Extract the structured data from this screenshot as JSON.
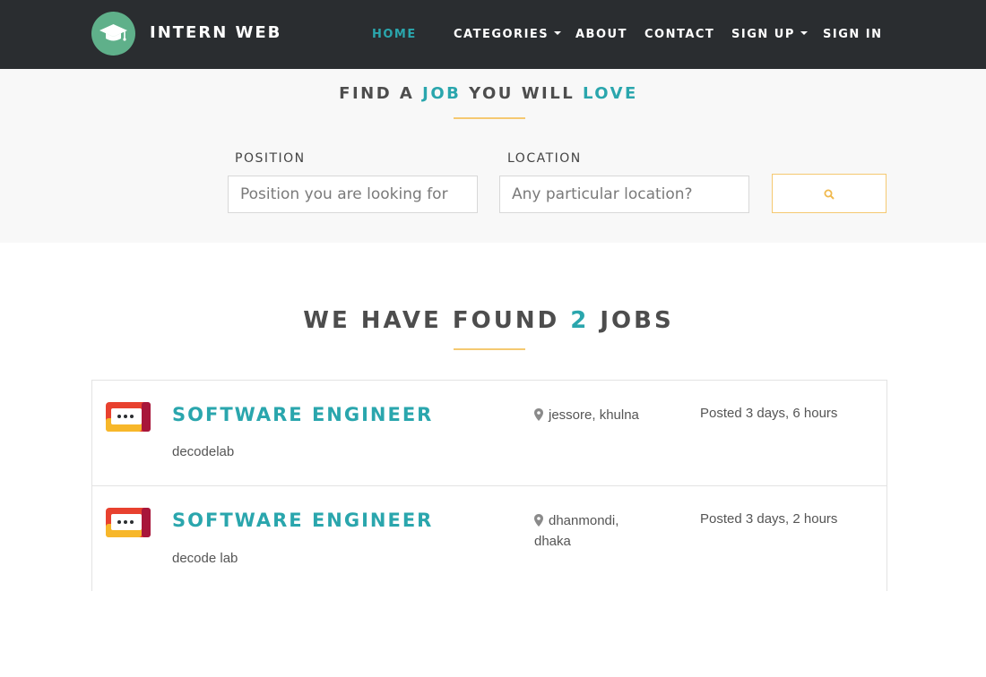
{
  "navbar": {
    "brand": "INTERN WEB",
    "items": [
      {
        "label": "HOME",
        "active": true
      },
      {
        "label": "CATEGORIES",
        "dropdown": true
      },
      {
        "label": "ABOUT"
      },
      {
        "label": "CONTACT"
      },
      {
        "label": "SIGN UP",
        "dropdown": true
      },
      {
        "label": "SIGN IN"
      }
    ]
  },
  "search": {
    "title_prefix": "FIND A ",
    "title_accent_1": "JOB",
    "title_middle": " YOU WILL ",
    "title_accent_2": "LOVE",
    "position_label": "POSITION",
    "position_placeholder": "Position you are looking for",
    "location_label": "LOCATION",
    "location_placeholder": "Any particular location?",
    "button_icon": "search-icon"
  },
  "results": {
    "title_prefix": "WE HAVE FOUND ",
    "count": "2",
    "title_suffix": " JOBS",
    "jobs": [
      {
        "title": "SOFTWARE ENGINEER",
        "company": "decodelab",
        "location_line1": "jessore, khulna",
        "location_line2": "",
        "posted": "Posted 3 days, 6 hours"
      },
      {
        "title": "SOFTWARE ENGINEER",
        "company": "decode lab",
        "location_line1": "dhanmondi,",
        "location_line2": "dhaka",
        "posted": "Posted 3 days, 2 hours"
      }
    ]
  },
  "colors": {
    "accent": "#2aa6ad",
    "navbar_bg": "#2a2d30",
    "underline": "#f5c971",
    "logo_green": "#5fb08a"
  }
}
